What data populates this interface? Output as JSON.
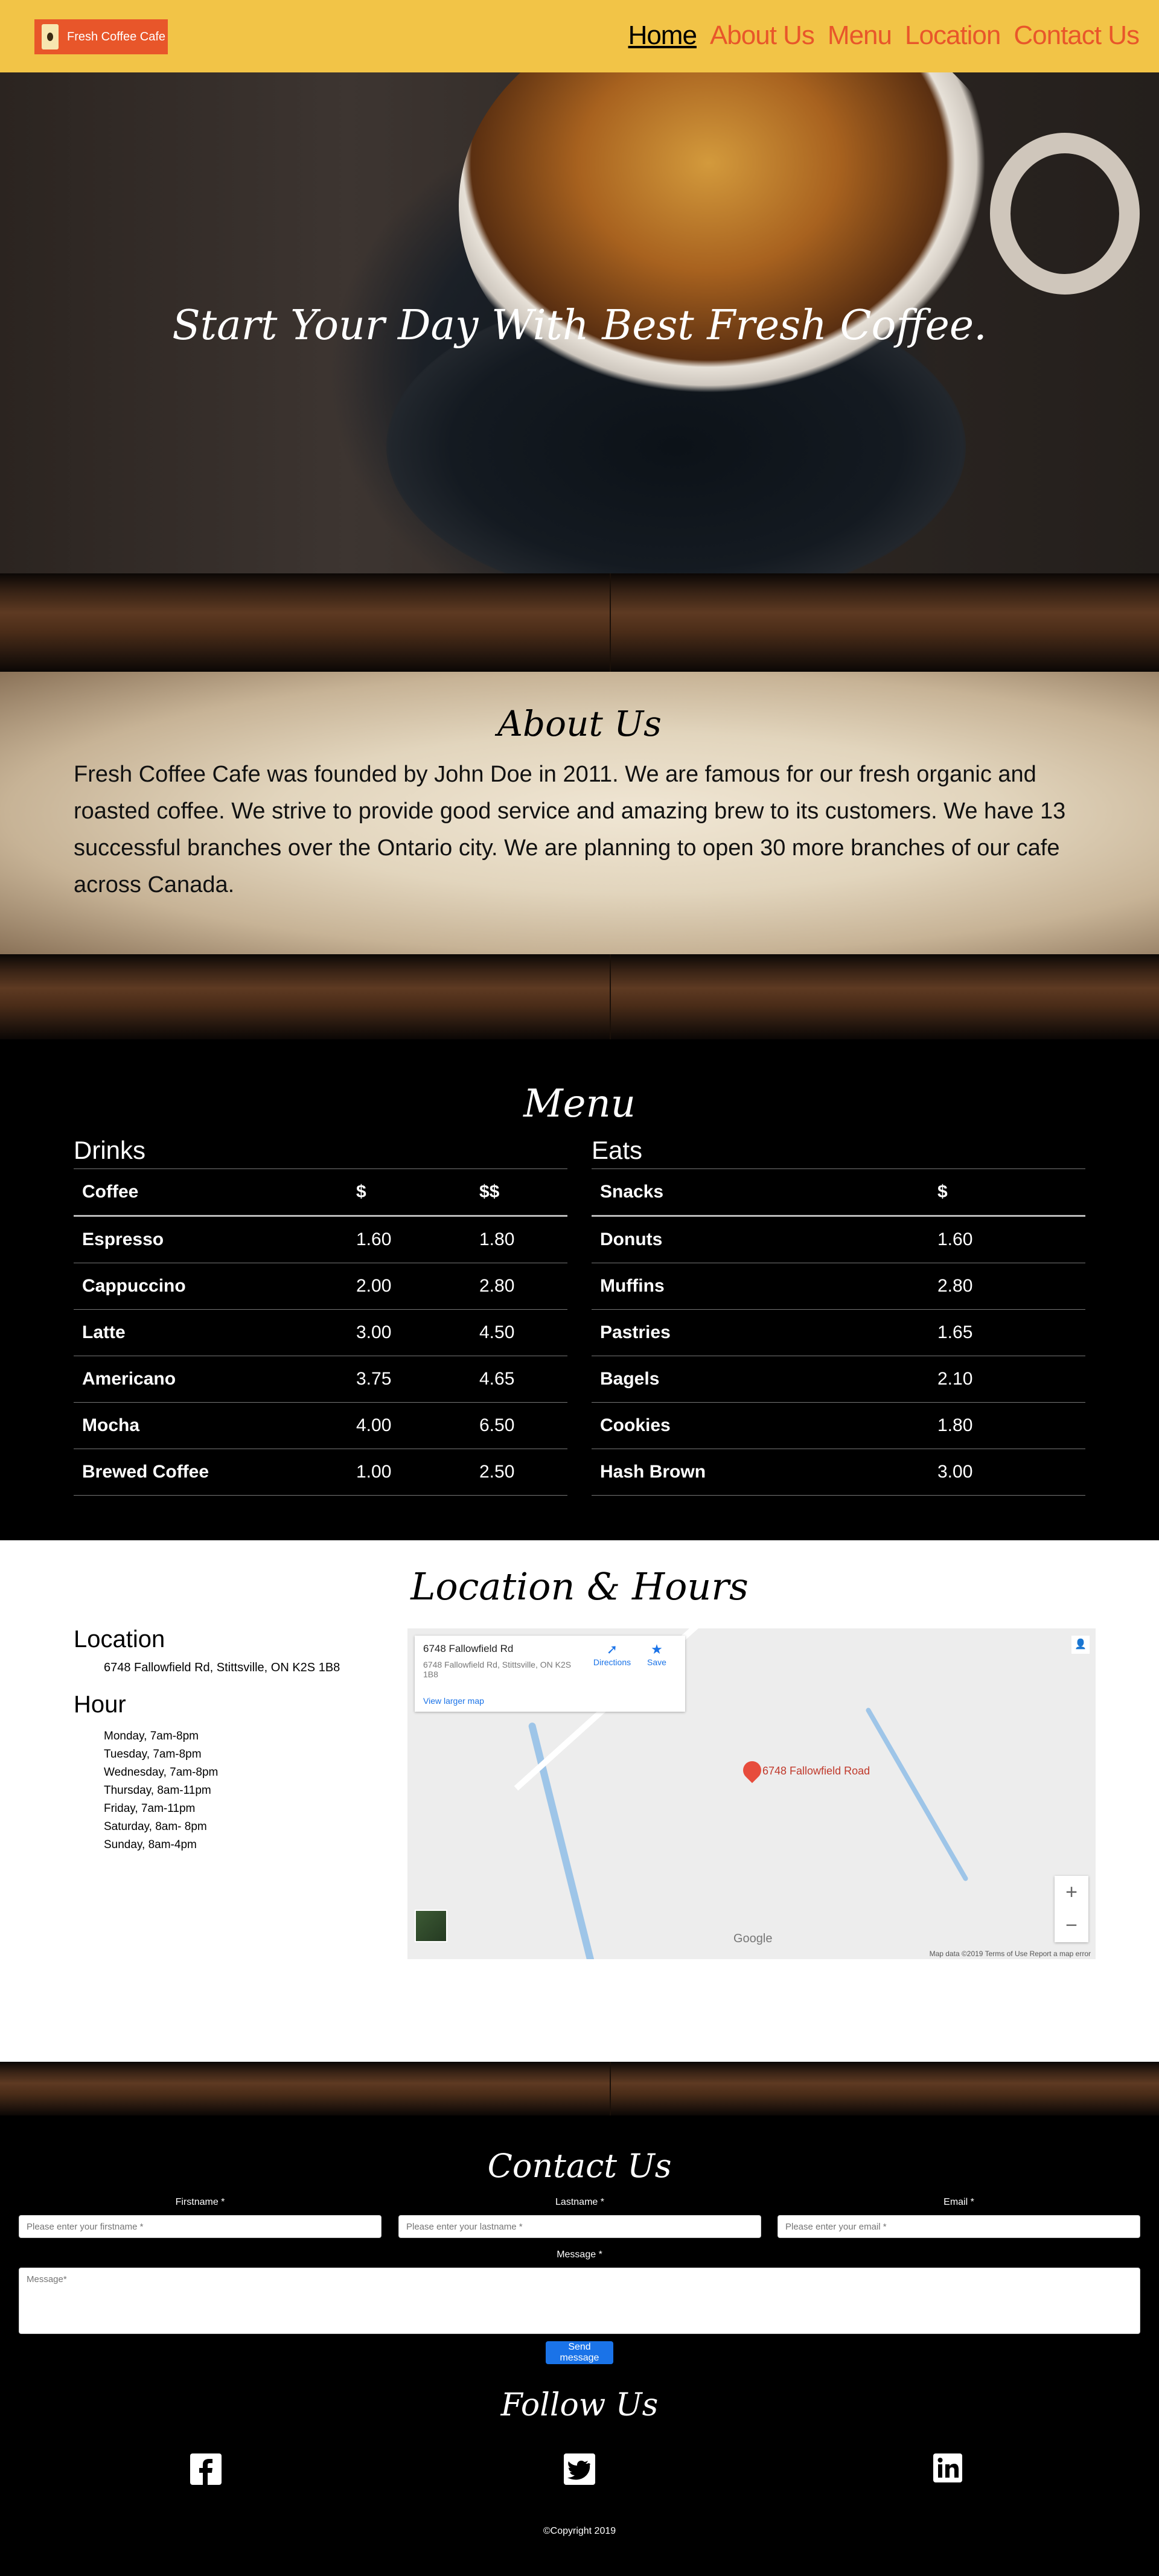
{
  "nav": {
    "brand": "Fresh Coffee Cafe",
    "links": [
      "Home",
      "About Us",
      "Menu",
      "Location",
      "Contact Us"
    ],
    "active": "Home"
  },
  "hero": {
    "headline": "Start Your Day With Best Fresh Coffee."
  },
  "about": {
    "title": "About Us",
    "text": "Fresh Coffee Cafe was founded by John Doe in 2011. We are famous for our fresh organic and roasted coffee. We strive to provide good service and amazing brew to its customers. We have 13 successful branches over the Ontario city. We are planning to open 30 more branches of our cafe across Canada."
  },
  "menu": {
    "title": "Menu",
    "drinks": {
      "heading": "Drinks",
      "columns": [
        "Coffee",
        "$",
        "$$"
      ],
      "rows": [
        [
          "Espresso",
          "1.60",
          "1.80"
        ],
        [
          "Cappuccino",
          "2.00",
          "2.80"
        ],
        [
          "Latte",
          "3.00",
          "4.50"
        ],
        [
          "Americano",
          "3.75",
          "4.65"
        ],
        [
          "Mocha",
          "4.00",
          "6.50"
        ],
        [
          "Brewed Coffee",
          "1.00",
          "2.50"
        ]
      ]
    },
    "eats": {
      "heading": "Eats",
      "columns": [
        "Snacks",
        "$"
      ],
      "rows": [
        [
          "Donuts",
          "1.60"
        ],
        [
          "Muffins",
          "2.80"
        ],
        [
          "Pastries",
          "1.65"
        ],
        [
          "Bagels",
          "2.10"
        ],
        [
          "Cookies",
          "1.80"
        ],
        [
          "Hash Brown",
          "3.00"
        ]
      ]
    }
  },
  "location": {
    "title": "Location & Hours",
    "location_heading": "Location",
    "address": "6748 Fallowfield Rd, Stittsville, ON K2S 1B8",
    "hours_heading": "Hour",
    "hours": [
      "Monday, 7am-8pm",
      "Tuesday, 7am-8pm",
      "Wednesday, 7am-8pm",
      "Thursday, 8am-11pm",
      "Friday, 7am-11pm",
      "Saturday, 8am- 8pm",
      "Sunday, 8am-4pm"
    ],
    "map": {
      "card_title": "6748 Fallowfield Rd",
      "card_address": "6748 Fallowfield Rd, Stittsville, ON K2S 1B8",
      "directions": "Directions",
      "save": "Save",
      "larger_map": "View larger map",
      "pin_label": "6748 Fallowfield Road",
      "footer": "Map data ©2019   Terms of Use   Report a map error",
      "google": "Google",
      "zoom_in": "+",
      "zoom_out": "−"
    }
  },
  "contact": {
    "title": "Contact Us",
    "firstname_label": "Firstname *",
    "firstname_placeholder": "Please enter your firstname *",
    "lastname_label": "Lastname *",
    "lastname_placeholder": "Please enter your lastname *",
    "email_label": "Email *",
    "email_placeholder": "Please enter your email *",
    "message_label": "Message *",
    "message_placeholder": "Message*",
    "send": "Send message",
    "follow": "Follow Us",
    "copyright": "©Copyright 2019"
  },
  "social": [
    "facebook-icon",
    "twitter-icon",
    "linkedin-icon"
  ]
}
